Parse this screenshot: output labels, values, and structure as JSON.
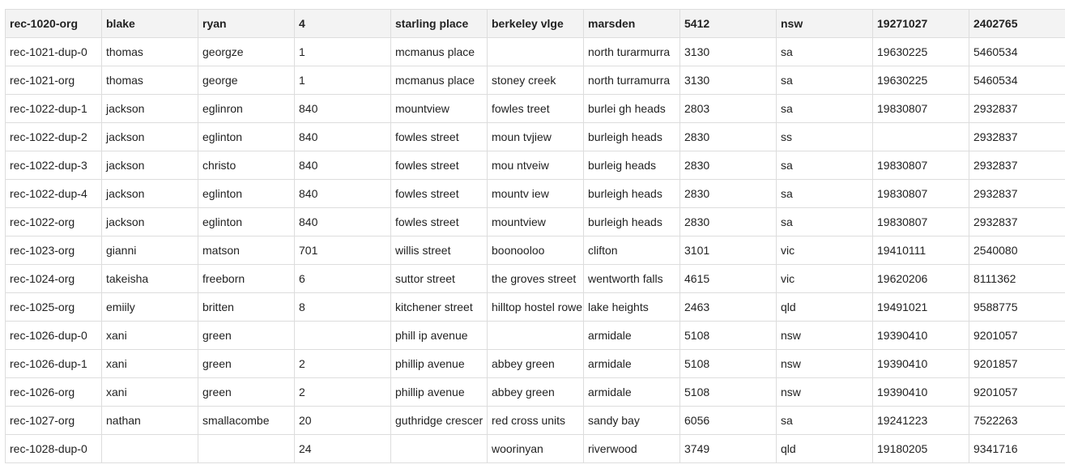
{
  "table": {
    "headers": [
      "rec-1020-org",
      "blake",
      "ryan",
      "4",
      "starling place",
      "berkeley vlge",
      "marsden",
      "5412",
      "nsw",
      "19271027",
      "2402765"
    ],
    "rows": [
      [
        "rec-1021-dup-0",
        "thomas",
        "georgze",
        "1",
        "mcmanus place",
        "",
        "north turarmurra",
        "3130",
        "sa",
        "19630225",
        "5460534"
      ],
      [
        "rec-1021-org",
        "thomas",
        "george",
        "1",
        "mcmanus place",
        "stoney creek",
        "north turramurra",
        "3130",
        "sa",
        "19630225",
        "5460534"
      ],
      [
        "rec-1022-dup-1",
        "jackson",
        "eglinron",
        "840",
        "mountview",
        "fowles treet",
        "burlei gh heads",
        "2803",
        "sa",
        "19830807",
        "2932837"
      ],
      [
        "rec-1022-dup-2",
        "jackson",
        "eglinton",
        "840",
        "fowles street",
        "moun tvjiew",
        "burleigh heads",
        "2830",
        "ss",
        "",
        "2932837"
      ],
      [
        "rec-1022-dup-3",
        "jackson",
        "christo",
        "840",
        "fowles street",
        "mou ntveiw",
        "burleig heads",
        "2830",
        "sa",
        "19830807",
        "2932837"
      ],
      [
        "rec-1022-dup-4",
        "jackson",
        "eglinton",
        "840",
        "fowles street",
        "mountv iew",
        "burleigh heads",
        "2830",
        "sa",
        "19830807",
        "2932837"
      ],
      [
        "rec-1022-org",
        "jackson",
        "eglinton",
        "840",
        "fowles street",
        "mountview",
        "burleigh heads",
        "2830",
        "sa",
        "19830807",
        "2932837"
      ],
      [
        "rec-1023-org",
        "gianni",
        "matson",
        "701",
        "willis street",
        "boonooloo",
        "clifton",
        "3101",
        "vic",
        "19410111",
        "2540080"
      ],
      [
        "rec-1024-org",
        "takeisha",
        "freeborn",
        "6",
        "suttor street",
        "the groves street",
        "wentworth falls",
        "4615",
        "vic",
        "19620206",
        "8111362"
      ],
      [
        "rec-1025-org",
        "emiily",
        "britten",
        "8",
        "kitchener street",
        "hilltop hostel rowe",
        "lake heights",
        "2463",
        "qld",
        "19491021",
        "9588775"
      ],
      [
        "rec-1026-dup-0",
        "xani",
        "green",
        "",
        "phill ip avenue",
        "",
        "armidale",
        "5108",
        "nsw",
        "19390410",
        "9201057"
      ],
      [
        "rec-1026-dup-1",
        "xani",
        "green",
        "2",
        "phillip avenue",
        "abbey green",
        "armidale",
        "5108",
        "nsw",
        "19390410",
        "9201857"
      ],
      [
        "rec-1026-org",
        "xani",
        "green",
        "2",
        "phillip avenue",
        "abbey green",
        "armidale",
        "5108",
        "nsw",
        "19390410",
        "9201057"
      ],
      [
        "rec-1027-org",
        "nathan",
        "smallacombe",
        "20",
        "guthridge crescer",
        "red cross units",
        "sandy bay",
        "6056",
        "sa",
        "19241223",
        "7522263"
      ],
      [
        "rec-1028-dup-0",
        "",
        "",
        "24",
        "",
        "woorinyan",
        "riverwood",
        "3749",
        "qld",
        "19180205",
        "9341716"
      ]
    ]
  }
}
